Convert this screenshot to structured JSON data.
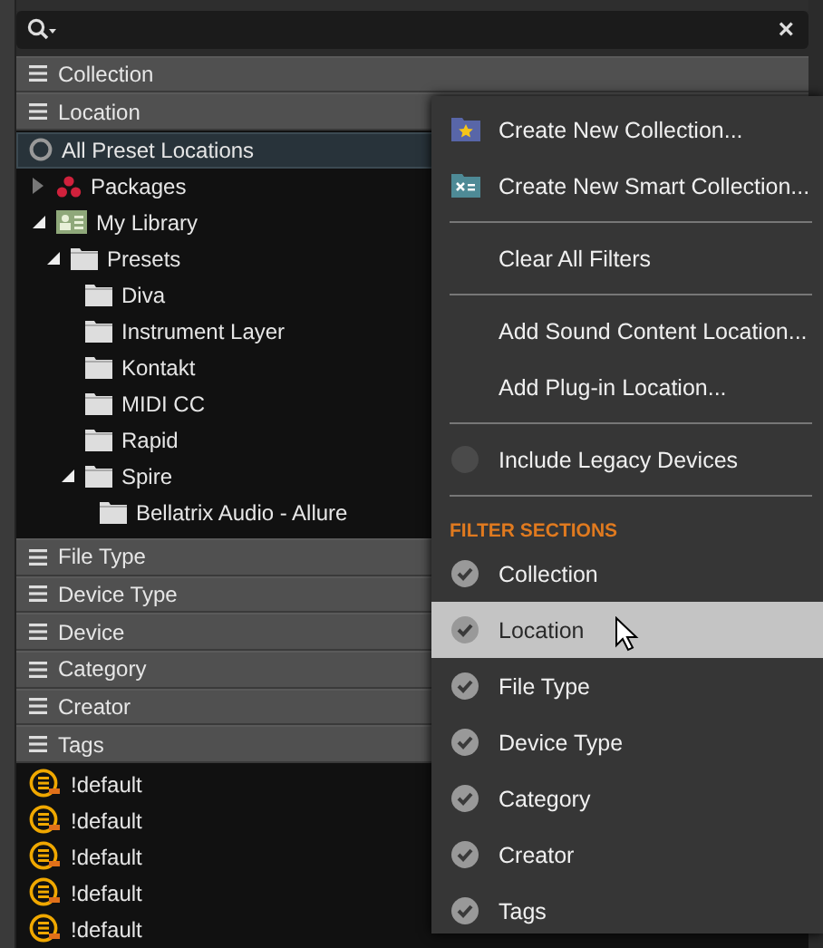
{
  "search": {
    "clear": "×"
  },
  "sections_top": [
    {
      "label": "Collection"
    },
    {
      "label": "Location"
    }
  ],
  "location_all": {
    "label": "All Preset Locations",
    "selected": true
  },
  "tree": [
    {
      "label": "Packages",
      "kind": "packages",
      "expanded": false
    },
    {
      "label": "My Library",
      "kind": "library",
      "expanded": true,
      "children": [
        {
          "label": "Presets",
          "kind": "folder",
          "expanded": true,
          "children": [
            {
              "label": "Diva",
              "kind": "folder"
            },
            {
              "label": "Instrument Layer",
              "kind": "folder"
            },
            {
              "label": "Kontakt",
              "kind": "folder"
            },
            {
              "label": "MIDI CC",
              "kind": "folder"
            },
            {
              "label": "Rapid",
              "kind": "folder"
            },
            {
              "label": "Spire",
              "kind": "folder",
              "expanded": true,
              "children": [
                {
                  "label": "Bellatrix Audio - Allure",
                  "kind": "folder"
                }
              ]
            }
          ]
        }
      ]
    }
  ],
  "sections_bottom": [
    {
      "label": "File Type"
    },
    {
      "label": "Device Type"
    },
    {
      "label": "Device"
    },
    {
      "label": "Category"
    },
    {
      "label": "Creator"
    },
    {
      "label": "Tags"
    }
  ],
  "tags": [
    {
      "label": "!default"
    },
    {
      "label": "!default"
    },
    {
      "label": "!default"
    },
    {
      "label": "!default"
    },
    {
      "label": "!default"
    }
  ],
  "menu": [
    {
      "kind": "collection",
      "label": "Create New Collection..."
    },
    {
      "kind": "smart-collection",
      "label": "Create New Smart Collection..."
    },
    {
      "kind": "divider"
    },
    {
      "kind": "action",
      "label": "Clear All Filters"
    },
    {
      "kind": "divider"
    },
    {
      "kind": "action",
      "label": "Add Sound Content Location..."
    },
    {
      "kind": "action",
      "label": "Add Plug-in Location..."
    },
    {
      "kind": "divider"
    },
    {
      "kind": "toggle",
      "label": "Include Legacy Devices",
      "checked": false
    },
    {
      "kind": "divider"
    },
    {
      "kind": "heading",
      "label": "FILTER SECTIONS"
    },
    {
      "kind": "toggle",
      "label": "Collection",
      "checked": true,
      "highlighted": false
    },
    {
      "kind": "toggle",
      "label": "Location",
      "checked": true,
      "highlighted": true
    },
    {
      "kind": "toggle",
      "label": "File Type",
      "checked": true,
      "highlighted": false
    },
    {
      "kind": "toggle",
      "label": "Device Type",
      "checked": true,
      "highlighted": false
    },
    {
      "kind": "toggle",
      "label": "Category",
      "checked": true,
      "highlighted": false
    },
    {
      "kind": "toggle",
      "label": "Creator",
      "checked": true,
      "highlighted": false
    },
    {
      "kind": "toggle",
      "label": "Tags",
      "checked": true,
      "highlighted": false
    }
  ]
}
